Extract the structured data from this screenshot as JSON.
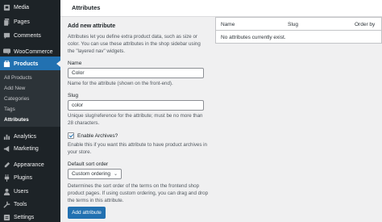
{
  "sidebar": {
    "items": [
      {
        "label": "Media",
        "icon": "media-icon"
      },
      {
        "label": "Pages",
        "icon": "pages-icon"
      },
      {
        "label": "Comments",
        "icon": "comments-icon"
      },
      {
        "label": "WooCommerce",
        "icon": "woocommerce-icon"
      },
      {
        "label": "Products",
        "icon": "products-icon"
      },
      {
        "label": "Analytics",
        "icon": "analytics-icon"
      },
      {
        "label": "Marketing",
        "icon": "marketing-icon"
      },
      {
        "label": "Appearance",
        "icon": "appearance-icon"
      },
      {
        "label": "Plugins",
        "icon": "plugins-icon"
      },
      {
        "label": "Users",
        "icon": "users-icon"
      },
      {
        "label": "Tools",
        "icon": "tools-icon"
      },
      {
        "label": "Settings",
        "icon": "settings-icon"
      }
    ],
    "submenu": [
      "All Products",
      "Add New",
      "Categories",
      "Tags",
      "Attributes"
    ]
  },
  "header": {
    "title": "Attributes"
  },
  "form": {
    "heading": "Add new attribute",
    "intro": "Attributes let you define extra product data, such as size or color. You can use these attributes in the shop sidebar using the \"layered nav\" widgets.",
    "name_label": "Name",
    "name_value": "Color",
    "name_help": "Name for the attribute (shown on the front-end).",
    "slug_label": "Slug",
    "slug_value": "color",
    "slug_help": "Unique slug/reference for the attribute; must be no more than 28 characters.",
    "archives_label": "Enable Archives?",
    "archives_checked": true,
    "archives_help": "Enable this if you want this attribute to have product archives in your store.",
    "sort_label": "Default sort order",
    "sort_value": "Custom ordering",
    "sort_help": "Determines the sort order of the terms on the frontend shop product pages. If using custom ordering, you can drag and drop the terms in this attribute.",
    "submit_label": "Add attribute"
  },
  "table": {
    "columns": [
      "Name",
      "Slug",
      "Order by"
    ],
    "empty_message": "No attributes currently exist."
  },
  "colors": {
    "accent": "#2271b1",
    "sidebar": "#1d2327"
  }
}
